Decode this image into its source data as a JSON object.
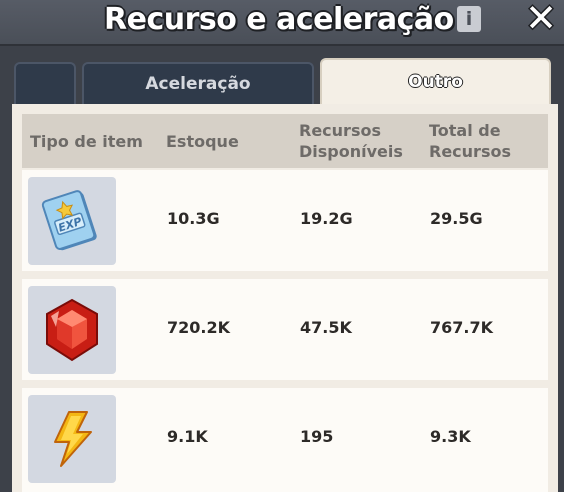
{
  "header": {
    "title": "Recurso e aceleração",
    "info_icon": "info-icon",
    "close_icon": "close-icon"
  },
  "tabs": [
    {
      "label": ""
    },
    {
      "label": "Aceleração"
    },
    {
      "label": "Outro",
      "selected": true
    }
  ],
  "table": {
    "columns": [
      "Tipo de item",
      "Estoque",
      "Recursos Disponíveis",
      "Total de Recursos"
    ],
    "rows": [
      {
        "icon": "exp-book-icon",
        "estoque": "10.3G",
        "disponiveis": "19.2G",
        "total": "29.5G"
      },
      {
        "icon": "red-gem-icon",
        "estoque": "720.2K",
        "disponiveis": "47.5K",
        "total": "767.7K"
      },
      {
        "icon": "lightning-icon",
        "estoque": "9.1K",
        "disponiveis": "195",
        "total": "9.3K"
      }
    ]
  },
  "colors": {
    "title_bar": "#50555e",
    "tab_inactive": "#2f3a4a",
    "tab_active": "#f4efe6",
    "header_row": "#d6d0c7",
    "row_bg": "#fdfbf7",
    "icon_bg": "#d3d8e1"
  }
}
